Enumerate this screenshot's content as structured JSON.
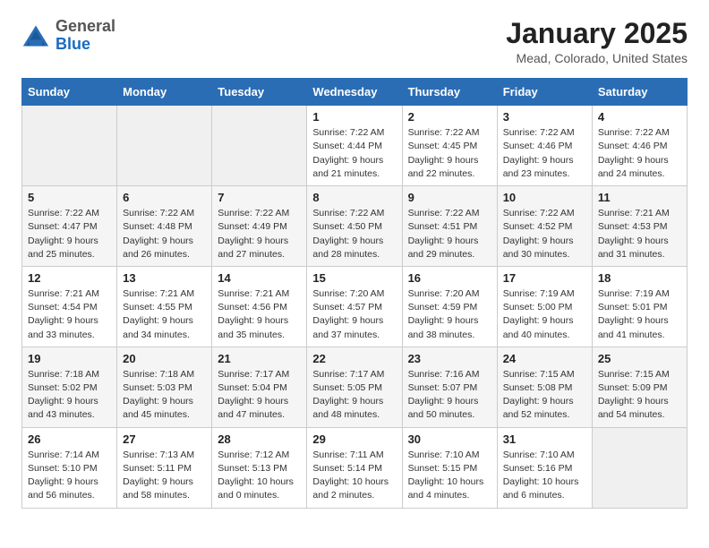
{
  "header": {
    "logo_general": "General",
    "logo_blue": "Blue",
    "title": "January 2025",
    "subtitle": "Mead, Colorado, United States"
  },
  "days_of_week": [
    "Sunday",
    "Monday",
    "Tuesday",
    "Wednesday",
    "Thursday",
    "Friday",
    "Saturday"
  ],
  "weeks": [
    [
      {
        "day": "",
        "info": ""
      },
      {
        "day": "",
        "info": ""
      },
      {
        "day": "",
        "info": ""
      },
      {
        "day": "1",
        "info": "Sunrise: 7:22 AM\nSunset: 4:44 PM\nDaylight: 9 hours\nand 21 minutes."
      },
      {
        "day": "2",
        "info": "Sunrise: 7:22 AM\nSunset: 4:45 PM\nDaylight: 9 hours\nand 22 minutes."
      },
      {
        "day": "3",
        "info": "Sunrise: 7:22 AM\nSunset: 4:46 PM\nDaylight: 9 hours\nand 23 minutes."
      },
      {
        "day": "4",
        "info": "Sunrise: 7:22 AM\nSunset: 4:46 PM\nDaylight: 9 hours\nand 24 minutes."
      }
    ],
    [
      {
        "day": "5",
        "info": "Sunrise: 7:22 AM\nSunset: 4:47 PM\nDaylight: 9 hours\nand 25 minutes."
      },
      {
        "day": "6",
        "info": "Sunrise: 7:22 AM\nSunset: 4:48 PM\nDaylight: 9 hours\nand 26 minutes."
      },
      {
        "day": "7",
        "info": "Sunrise: 7:22 AM\nSunset: 4:49 PM\nDaylight: 9 hours\nand 27 minutes."
      },
      {
        "day": "8",
        "info": "Sunrise: 7:22 AM\nSunset: 4:50 PM\nDaylight: 9 hours\nand 28 minutes."
      },
      {
        "day": "9",
        "info": "Sunrise: 7:22 AM\nSunset: 4:51 PM\nDaylight: 9 hours\nand 29 minutes."
      },
      {
        "day": "10",
        "info": "Sunrise: 7:22 AM\nSunset: 4:52 PM\nDaylight: 9 hours\nand 30 minutes."
      },
      {
        "day": "11",
        "info": "Sunrise: 7:21 AM\nSunset: 4:53 PM\nDaylight: 9 hours\nand 31 minutes."
      }
    ],
    [
      {
        "day": "12",
        "info": "Sunrise: 7:21 AM\nSunset: 4:54 PM\nDaylight: 9 hours\nand 33 minutes."
      },
      {
        "day": "13",
        "info": "Sunrise: 7:21 AM\nSunset: 4:55 PM\nDaylight: 9 hours\nand 34 minutes."
      },
      {
        "day": "14",
        "info": "Sunrise: 7:21 AM\nSunset: 4:56 PM\nDaylight: 9 hours\nand 35 minutes."
      },
      {
        "day": "15",
        "info": "Sunrise: 7:20 AM\nSunset: 4:57 PM\nDaylight: 9 hours\nand 37 minutes."
      },
      {
        "day": "16",
        "info": "Sunrise: 7:20 AM\nSunset: 4:59 PM\nDaylight: 9 hours\nand 38 minutes."
      },
      {
        "day": "17",
        "info": "Sunrise: 7:19 AM\nSunset: 5:00 PM\nDaylight: 9 hours\nand 40 minutes."
      },
      {
        "day": "18",
        "info": "Sunrise: 7:19 AM\nSunset: 5:01 PM\nDaylight: 9 hours\nand 41 minutes."
      }
    ],
    [
      {
        "day": "19",
        "info": "Sunrise: 7:18 AM\nSunset: 5:02 PM\nDaylight: 9 hours\nand 43 minutes."
      },
      {
        "day": "20",
        "info": "Sunrise: 7:18 AM\nSunset: 5:03 PM\nDaylight: 9 hours\nand 45 minutes."
      },
      {
        "day": "21",
        "info": "Sunrise: 7:17 AM\nSunset: 5:04 PM\nDaylight: 9 hours\nand 47 minutes."
      },
      {
        "day": "22",
        "info": "Sunrise: 7:17 AM\nSunset: 5:05 PM\nDaylight: 9 hours\nand 48 minutes."
      },
      {
        "day": "23",
        "info": "Sunrise: 7:16 AM\nSunset: 5:07 PM\nDaylight: 9 hours\nand 50 minutes."
      },
      {
        "day": "24",
        "info": "Sunrise: 7:15 AM\nSunset: 5:08 PM\nDaylight: 9 hours\nand 52 minutes."
      },
      {
        "day": "25",
        "info": "Sunrise: 7:15 AM\nSunset: 5:09 PM\nDaylight: 9 hours\nand 54 minutes."
      }
    ],
    [
      {
        "day": "26",
        "info": "Sunrise: 7:14 AM\nSunset: 5:10 PM\nDaylight: 9 hours\nand 56 minutes."
      },
      {
        "day": "27",
        "info": "Sunrise: 7:13 AM\nSunset: 5:11 PM\nDaylight: 9 hours\nand 58 minutes."
      },
      {
        "day": "28",
        "info": "Sunrise: 7:12 AM\nSunset: 5:13 PM\nDaylight: 10 hours\nand 0 minutes."
      },
      {
        "day": "29",
        "info": "Sunrise: 7:11 AM\nSunset: 5:14 PM\nDaylight: 10 hours\nand 2 minutes."
      },
      {
        "day": "30",
        "info": "Sunrise: 7:10 AM\nSunset: 5:15 PM\nDaylight: 10 hours\nand 4 minutes."
      },
      {
        "day": "31",
        "info": "Sunrise: 7:10 AM\nSunset: 5:16 PM\nDaylight: 10 hours\nand 6 minutes."
      },
      {
        "day": "",
        "info": ""
      }
    ]
  ]
}
